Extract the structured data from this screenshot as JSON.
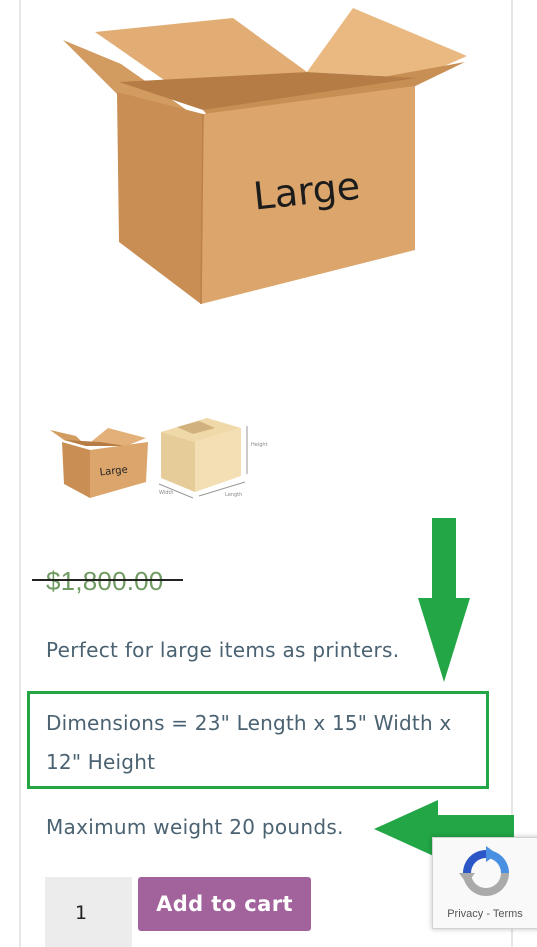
{
  "product": {
    "main_image_label": "Large",
    "thumbnail_1_label": "Large",
    "thumbnail_2_labels": {
      "height": "Height",
      "length": "Length",
      "width": "Width"
    },
    "price": "$1,800.00",
    "description": "Perfect for large items as printers.",
    "dimensions": "Dimensions = 23\" Length x 15\" Width x 12\" Height",
    "max_weight": "Maximum weight 20 pounds."
  },
  "cart": {
    "quantity": "1",
    "add_to_cart_label": "Add to cart"
  },
  "recaptcha": {
    "privacy_label": "Privacy",
    "separator": " - ",
    "terms_label": "Terms"
  },
  "colors": {
    "price": "#6f9a62",
    "button": "#a2629b",
    "highlight_box": "#22a646",
    "annotation_arrow": "#22a646",
    "body_text": "#4a6271",
    "box_cardboard": "#d9a066"
  }
}
